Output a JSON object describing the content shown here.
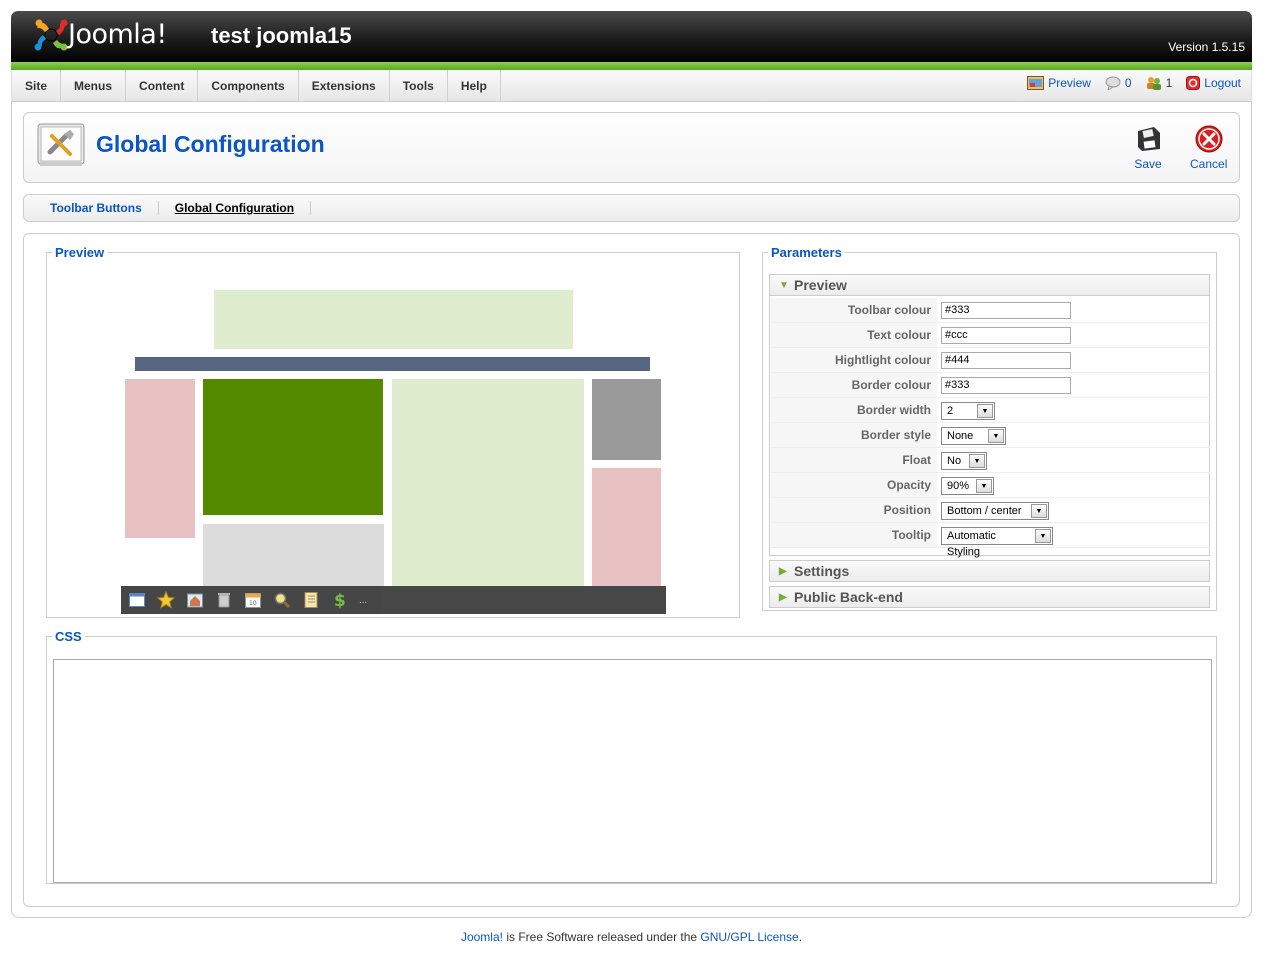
{
  "header": {
    "logo_text": "Joomla!",
    "site_name": "test joomla15",
    "version": "Version 1.5.15"
  },
  "menu": [
    {
      "label": "Site"
    },
    {
      "label": "Menus"
    },
    {
      "label": "Content"
    },
    {
      "label": "Components"
    },
    {
      "label": "Extensions"
    },
    {
      "label": "Tools"
    },
    {
      "label": "Help"
    }
  ],
  "status": {
    "preview": "Preview",
    "messages": "0",
    "users": "1",
    "logout": "Logout"
  },
  "toolbar": {
    "title": "Global Configuration",
    "save_label": "Save",
    "cancel_label": "Cancel"
  },
  "submenu": [
    {
      "label": "Toolbar Buttons",
      "active": false
    },
    {
      "label": "Global Configuration",
      "active": true
    }
  ],
  "preview_section": {
    "legend": "Preview",
    "more": "..."
  },
  "parameters": {
    "legend": "Parameters",
    "panes": {
      "preview": "Preview",
      "settings": "Settings",
      "public_backend": "Public Back-end"
    },
    "rows": [
      {
        "label": "Toolbar colour",
        "type": "text",
        "value": "#333"
      },
      {
        "label": "Text colour",
        "type": "text",
        "value": "#ccc"
      },
      {
        "label": "Hightlight colour",
        "type": "text",
        "value": "#444"
      },
      {
        "label": "Border colour",
        "type": "text",
        "value": "#333"
      },
      {
        "label": "Border width",
        "type": "select",
        "value": "2"
      },
      {
        "label": "Border style",
        "type": "select",
        "value": "None"
      },
      {
        "label": "Float",
        "type": "select",
        "value": "No"
      },
      {
        "label": "Opacity",
        "type": "select",
        "value": "90%"
      },
      {
        "label": "Position",
        "type": "select",
        "value": "Bottom / center"
      },
      {
        "label": "Tooltip",
        "type": "select",
        "value": "Automatic Styling"
      }
    ]
  },
  "css_section": {
    "legend": "CSS",
    "value": ""
  },
  "footer": {
    "link1": "Joomla!",
    "text": " is Free Software released under the ",
    "link2": "GNU/GPL License",
    "end": "."
  },
  "colors": {
    "accent": "#0b55c4",
    "header_green": "#5aa52a",
    "preview_light_green": "#dfecce",
    "preview_dark_green": "#538a00",
    "preview_navy": "#566580",
    "preview_pink": "#e8c1c3",
    "preview_gray": "#9a9a9a",
    "preview_light_gray": "#dcdcdc",
    "preview_toolbar": "#333333"
  }
}
